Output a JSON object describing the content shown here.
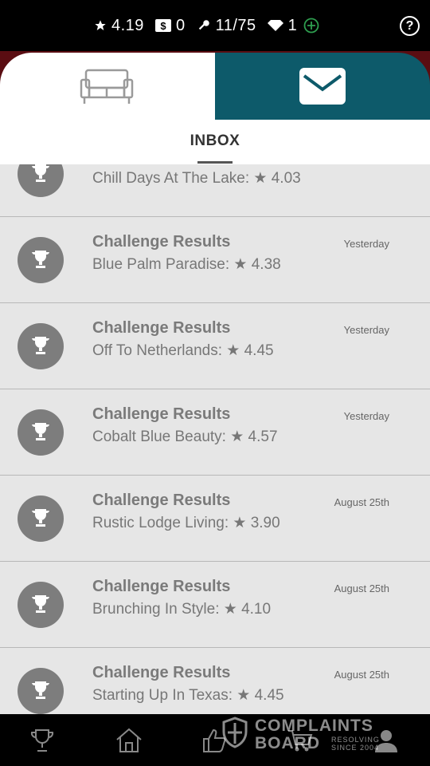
{
  "status": {
    "rating": "4.19",
    "cash": "0",
    "keys": "11/75",
    "diamonds": "1",
    "icons": [
      "star-icon",
      "dollar-icon",
      "key-icon",
      "diamond-icon",
      "plus-circle-icon",
      "help-icon"
    ],
    "help_label": "?"
  },
  "tabs": {
    "left_icon": "sofa-icon",
    "right_icon": "mail-icon",
    "accent_left": "#ffffff",
    "accent_right": "#0d5a6a"
  },
  "inbox": {
    "title": "INBOX"
  },
  "messages": [
    {
      "title": "",
      "subtitle": "Chill Days At The Lake: ★ 4.03",
      "date": ""
    },
    {
      "title": "Challenge Results",
      "subtitle": "Blue Palm Paradise: ★ 4.38",
      "date": "Yesterday"
    },
    {
      "title": "Challenge Results",
      "subtitle": "Off To Netherlands: ★ 4.45",
      "date": "Yesterday"
    },
    {
      "title": "Challenge Results",
      "subtitle": "Cobalt Blue Beauty: ★ 4.57",
      "date": "Yesterday"
    },
    {
      "title": "Challenge Results",
      "subtitle": "Rustic Lodge Living: ★ 3.90",
      "date": "August 25th"
    },
    {
      "title": "Challenge Results",
      "subtitle": "Brunching In Style: ★ 4.10",
      "date": "August 25th"
    },
    {
      "title": "Challenge Results",
      "subtitle": "Starting Up In Texas: ★ 4.45",
      "date": "August 25th"
    }
  ],
  "bottom_nav": {
    "icons": [
      "trophy-icon",
      "house-icon",
      "thumbs-up-icon",
      "cart-icon",
      "person-icon"
    ]
  },
  "watermark": {
    "line1": "COMPLAINTS",
    "line2": "BOARD",
    "line3": "RESOLVING SINCE 2004"
  }
}
